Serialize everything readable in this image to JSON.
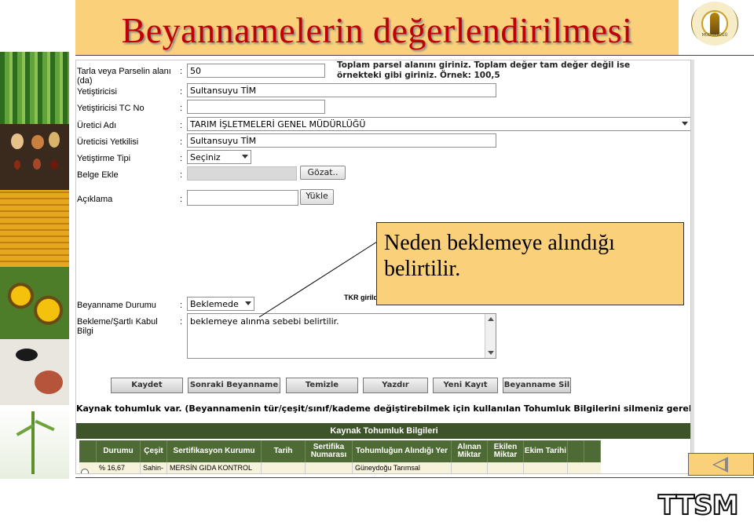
{
  "slide": {
    "title": "Beyannamelerin değerlendirilmesi",
    "footer_logo": "TTSM",
    "nav_back_icon": "back-arrow-icon",
    "accent_color": "#fbd07a",
    "title_color": "#c00000"
  },
  "logo": {
    "icon": "wheat-seal-icon",
    "caption": "MÜDÜRLÜĞÜ"
  },
  "form": {
    "note": "Toplam parsel alanını giriniz. Toplam değer tam değer değil ise örnekteki gibi giriniz. Örnek: 100,5",
    "fields": {
      "parsel": {
        "label": "Tarla veya Parselin alanı (da)",
        "value": "50"
      },
      "yetistirici": {
        "label": "Yetiştiricisi",
        "value": "Sultansuyu TİM"
      },
      "tc_no": {
        "label": "Yetiştiricisi TC No",
        "value": ""
      },
      "uretici": {
        "label": "Üretici Adı",
        "value": "TARIM İŞLETMELERİ GENEL MÜDÜRLÜĞÜ"
      },
      "yetkili": {
        "label": "Üreticisi Yetkilisi",
        "value": "Sultansuyu TİM"
      },
      "tip": {
        "label": "Yetiştirme Tipi",
        "value": "Seçiniz"
      },
      "belge": {
        "label": "Belge Ekle",
        "browse": "Gözat.."
      },
      "aciklama": {
        "label": "Açıklama",
        "upload": "Yükle"
      },
      "durum": {
        "label": "Beyanname Durumu",
        "value": "Beklemede"
      },
      "bekleme": {
        "label": "Bekleme/Şartlı Kabul Bilgi",
        "value": "beklemeye alınma sebebi belirtilir."
      }
    },
    "tkr_text": "TKR girildi",
    "actions": [
      "Kaydet",
      "Sonraki Beyanname",
      "Temizle",
      "Yazdır",
      "Yeni Kayıt",
      "Beyanname Sil"
    ],
    "warning": "Kaynak tohumluk var. (Beyannamenin tür/çeşit/sınıf/kademe değiştirebilmek için kullanılan Tohumluk Bilgilerini silmeniz gerekir",
    "table": {
      "title": "Kaynak Tohumluk Bilgileri",
      "columns": [
        "Durumu",
        "Çeşit",
        "Sertifikasyon Kurumu",
        "Tarih",
        "Sertifika Numarası",
        "Tohumluğun Alındığı Yer",
        "Alınan Miktar",
        "Ekilen Miktar",
        "Ekim Tarihi"
      ],
      "row": [
        "% 16,67",
        "Sahin-",
        "MERSİN GIDA KONTROL",
        "",
        "",
        "Güneydoğu Tarımsal",
        "",
        "",
        ""
      ],
      "header_color": "#3d5329"
    }
  },
  "callout": {
    "text": "Neden beklemeye alındığı belirtilir."
  }
}
